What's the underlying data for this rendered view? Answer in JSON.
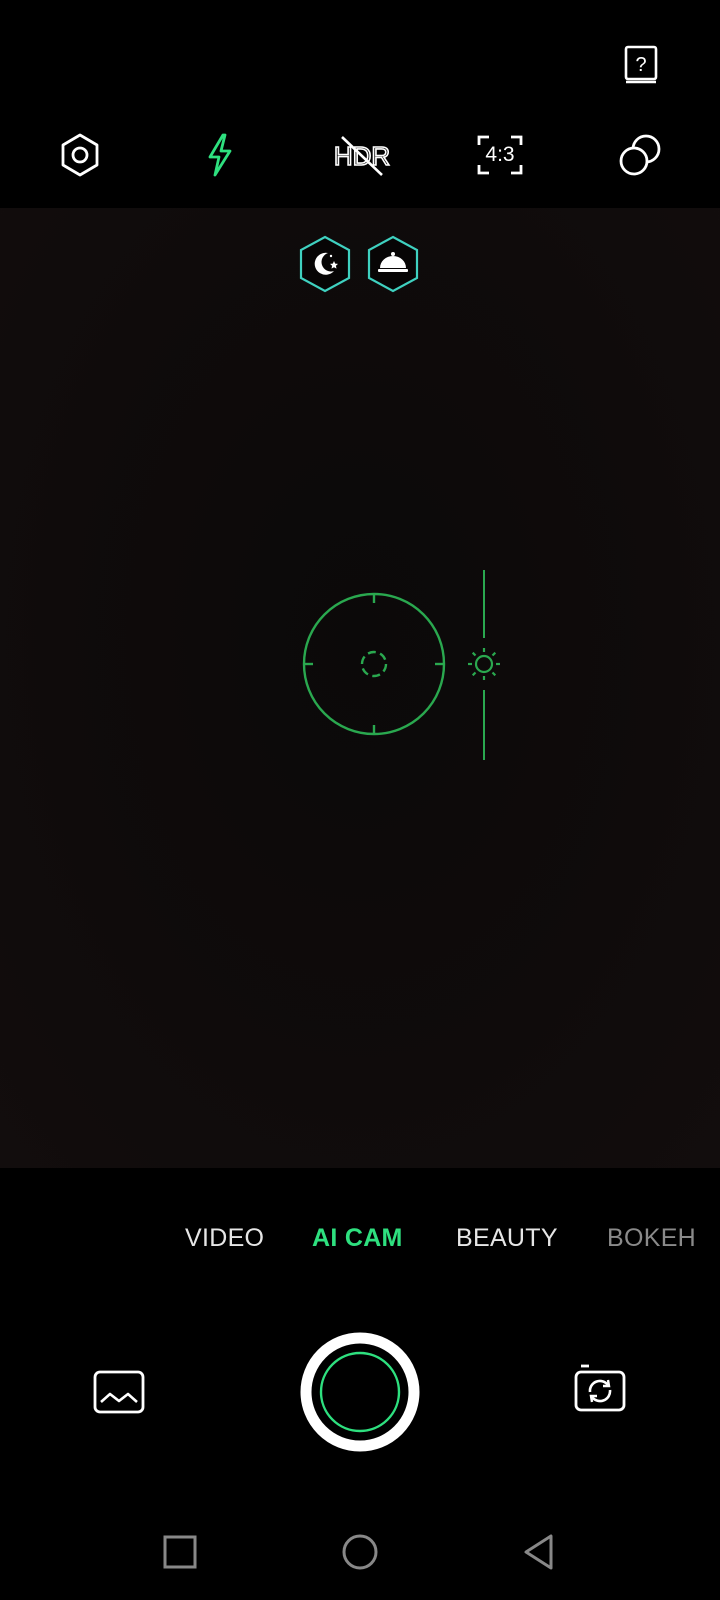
{
  "colors": {
    "accent": "#2ee07f",
    "focus": "#2aa84f",
    "badge_stroke": "#3fd1c0",
    "text": "#e6e6e6",
    "text_dim": "#9a9a9a"
  },
  "top_bar": {
    "help_icon": "help-book-icon",
    "icons": [
      "settings-icon",
      "flash-icon",
      "hdr-off-icon",
      "aspect-ratio-icon",
      "filters-icon"
    ],
    "aspect_ratio": "4:3",
    "hdr_label": "HDR"
  },
  "scene_badges": [
    "night-mode-icon",
    "food-mode-icon"
  ],
  "modes": {
    "items": [
      "VIDEO",
      "AI CAM",
      "BEAUTY",
      "BOKEH"
    ],
    "selected": "AI CAM"
  },
  "bottom_controls": {
    "gallery": "gallery-thumbnail-icon",
    "shutter": "shutter-button",
    "switch": "switch-camera-icon"
  },
  "nav_bar": [
    "recents-button",
    "home-button",
    "back-button"
  ]
}
